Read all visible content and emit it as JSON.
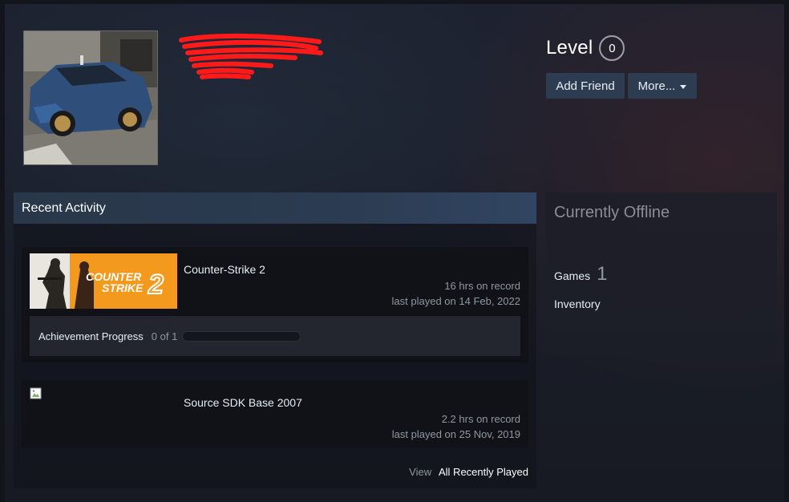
{
  "profile": {
    "level_label": "Level",
    "level_value": "0",
    "buttons": {
      "add_friend": "Add Friend",
      "more": "More..."
    }
  },
  "recent_activity": {
    "title": "Recent Activity",
    "games": [
      {
        "name": "Counter-Strike 2",
        "hours": "16 hrs on record",
        "last_played": "last played on 14 Feb, 2022",
        "achievement_label": "Achievement Progress",
        "achievement_count": "0 of 1",
        "achievement_progress": 0
      },
      {
        "name": "Source SDK Base 2007",
        "hours": "2.2 hrs on record",
        "last_played": "last played on 25 Nov, 2019"
      }
    ],
    "view_label": "View",
    "view_link": "All Recently Played"
  },
  "sidebar": {
    "status": "Currently Offline",
    "games_label": "Games",
    "games_count": "1",
    "inventory_label": "Inventory"
  },
  "icons": {
    "capsule_logo": "COUNTER STRIKE 2",
    "broken_image": "broken-image-icon"
  },
  "colors": {
    "accent_orange": "#f39a1e",
    "header_blue": "#2b3b50",
    "scribble_red": "#ff1a1a"
  }
}
